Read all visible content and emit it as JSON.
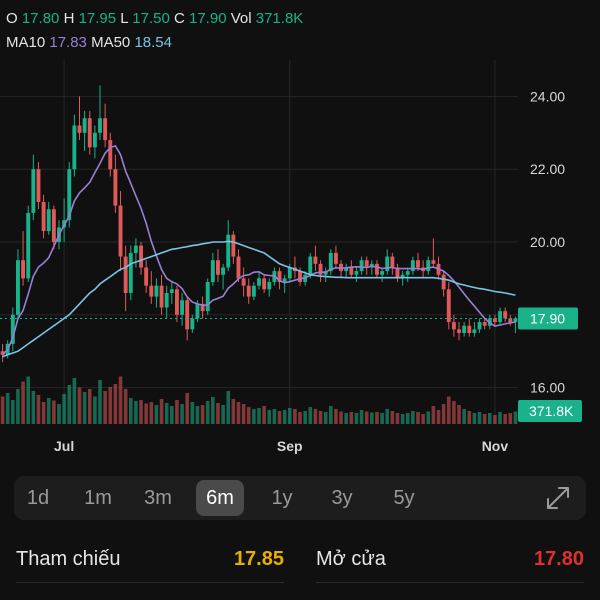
{
  "header": {
    "o_label": "O",
    "o_value": "17.80",
    "h_label": "H",
    "h_value": "17.95",
    "l_label": "L",
    "l_value": "17.50",
    "c_label": "C",
    "c_value": "17.90",
    "vol_label": "Vol",
    "vol_value": "371.8K",
    "ma10_label": "MA10",
    "ma10_value": "17.83",
    "ma50_label": "MA50",
    "ma50_value": "18.54"
  },
  "colors": {
    "up": "#19b28a",
    "down": "#e05a5a",
    "ma10": "#9a7fd6",
    "ma50": "#7cc4e6",
    "ref": "#e8b000"
  },
  "chart_data": {
    "type": "candlestick",
    "y_ticks": [
      "24.00",
      "22.00",
      "20.00",
      "16.00"
    ],
    "ylim": [
      15.0,
      25.0
    ],
    "x_ticks": [
      {
        "label": "Jul",
        "index": 12
      },
      {
        "label": "Sep",
        "index": 56
      },
      {
        "label": "Nov",
        "index": 96
      }
    ],
    "last_price_label": "17.90",
    "last_price": 17.9,
    "last_volume_label": "371.8K",
    "candles": [
      [
        17.0,
        17.2,
        16.7,
        16.9
      ],
      [
        16.9,
        17.3,
        16.8,
        17.2
      ],
      [
        17.2,
        18.2,
        17.0,
        18.0
      ],
      [
        18.0,
        19.8,
        17.9,
        19.5
      ],
      [
        19.5,
        20.3,
        18.8,
        19.0
      ],
      [
        19.0,
        21.0,
        18.9,
        20.8
      ],
      [
        20.8,
        22.4,
        20.6,
        22.0
      ],
      [
        22.0,
        22.2,
        20.9,
        21.1
      ],
      [
        21.1,
        21.3,
        20.1,
        20.3
      ],
      [
        20.3,
        21.1,
        20.2,
        20.9
      ],
      [
        20.9,
        21.0,
        19.8,
        20.0
      ],
      [
        20.0,
        20.6,
        19.8,
        20.4
      ],
      [
        20.4,
        21.2,
        20.0,
        20.6
      ],
      [
        20.6,
        22.2,
        20.4,
        22.0
      ],
      [
        22.0,
        23.5,
        21.8,
        23.2
      ],
      [
        23.2,
        24.0,
        22.8,
        23.0
      ],
      [
        23.0,
        23.6,
        22.5,
        23.4
      ],
      [
        23.4,
        23.6,
        22.4,
        22.6
      ],
      [
        22.6,
        23.2,
        22.3,
        23.0
      ],
      [
        23.0,
        24.3,
        22.8,
        23.4
      ],
      [
        23.4,
        23.8,
        22.6,
        22.8
      ],
      [
        22.8,
        23.0,
        21.8,
        22.0
      ],
      [
        22.0,
        22.4,
        20.8,
        21.0
      ],
      [
        21.0,
        21.4,
        19.2,
        19.6
      ],
      [
        19.6,
        19.9,
        18.1,
        18.6
      ],
      [
        18.6,
        19.9,
        18.4,
        19.7
      ],
      [
        19.7,
        20.1,
        19.3,
        19.9
      ],
      [
        19.9,
        20.0,
        19.1,
        19.3
      ],
      [
        19.3,
        19.5,
        18.6,
        18.8
      ],
      [
        18.8,
        19.2,
        18.3,
        18.5
      ],
      [
        18.5,
        19.0,
        18.2,
        18.8
      ],
      [
        18.8,
        19.1,
        18.0,
        18.2
      ],
      [
        18.2,
        18.8,
        17.9,
        18.6
      ],
      [
        18.6,
        18.9,
        18.3,
        18.7
      ],
      [
        18.7,
        18.8,
        17.8,
        18.0
      ],
      [
        18.0,
        18.6,
        17.7,
        18.4
      ],
      [
        18.4,
        18.5,
        17.3,
        17.6
      ],
      [
        17.6,
        18.0,
        17.5,
        17.9
      ],
      [
        17.9,
        18.4,
        17.8,
        18.3
      ],
      [
        18.3,
        18.5,
        17.9,
        18.1
      ],
      [
        18.1,
        19.0,
        18.0,
        18.9
      ],
      [
        18.9,
        19.7,
        18.8,
        19.5
      ],
      [
        19.5,
        19.8,
        18.9,
        19.1
      ],
      [
        19.1,
        19.4,
        18.7,
        19.3
      ],
      [
        19.3,
        20.6,
        19.2,
        20.2
      ],
      [
        20.2,
        20.3,
        19.4,
        19.6
      ],
      [
        19.6,
        19.8,
        18.9,
        19.0
      ],
      [
        19.0,
        19.3,
        18.5,
        18.8
      ],
      [
        18.8,
        19.0,
        18.3,
        18.5
      ],
      [
        18.5,
        18.9,
        18.4,
        18.8
      ],
      [
        18.8,
        19.2,
        18.7,
        19.0
      ],
      [
        19.0,
        19.1,
        18.6,
        18.7
      ],
      [
        18.7,
        19.0,
        18.5,
        18.9
      ],
      [
        18.9,
        19.3,
        18.8,
        19.2
      ],
      [
        19.2,
        19.3,
        18.7,
        18.9
      ],
      [
        18.9,
        19.1,
        18.6,
        19.0
      ],
      [
        19.0,
        19.4,
        18.9,
        19.3
      ],
      [
        19.3,
        19.6,
        19.0,
        19.2
      ],
      [
        19.2,
        19.3,
        18.8,
        18.9
      ],
      [
        18.9,
        19.2,
        18.8,
        19.1
      ],
      [
        19.1,
        19.7,
        19.0,
        19.6
      ],
      [
        19.6,
        19.9,
        19.2,
        19.4
      ],
      [
        19.4,
        19.5,
        18.9,
        19.1
      ],
      [
        19.1,
        19.3,
        18.9,
        19.2
      ],
      [
        19.2,
        19.8,
        19.1,
        19.7
      ],
      [
        19.7,
        19.9,
        19.3,
        19.4
      ],
      [
        19.4,
        19.5,
        19.0,
        19.2
      ],
      [
        19.2,
        19.4,
        19.0,
        19.3
      ],
      [
        19.3,
        19.5,
        19.0,
        19.1
      ],
      [
        19.1,
        19.3,
        18.9,
        19.2
      ],
      [
        19.2,
        19.6,
        19.1,
        19.5
      ],
      [
        19.5,
        19.6,
        19.1,
        19.3
      ],
      [
        19.3,
        19.5,
        19.1,
        19.4
      ],
      [
        19.4,
        19.5,
        19.0,
        19.1
      ],
      [
        19.1,
        19.3,
        18.9,
        19.2
      ],
      [
        19.2,
        19.8,
        19.1,
        19.6
      ],
      [
        19.6,
        19.7,
        19.1,
        19.3
      ],
      [
        19.3,
        19.4,
        18.9,
        19.0
      ],
      [
        19.0,
        19.2,
        18.8,
        19.1
      ],
      [
        19.1,
        19.3,
        18.9,
        19.2
      ],
      [
        19.2,
        19.6,
        19.1,
        19.5
      ],
      [
        19.5,
        19.7,
        19.2,
        19.3
      ],
      [
        19.3,
        19.5,
        19.0,
        19.2
      ],
      [
        19.2,
        19.6,
        19.1,
        19.5
      ],
      [
        19.5,
        20.1,
        19.3,
        19.4
      ],
      [
        19.4,
        19.6,
        19.0,
        19.1
      ],
      [
        19.1,
        19.2,
        18.5,
        18.7
      ],
      [
        18.7,
        18.9,
        17.6,
        17.8
      ],
      [
        17.8,
        18.0,
        17.4,
        17.6
      ],
      [
        17.6,
        17.8,
        17.3,
        17.5
      ],
      [
        17.5,
        17.8,
        17.4,
        17.7
      ],
      [
        17.7,
        17.9,
        17.4,
        17.5
      ],
      [
        17.5,
        17.8,
        17.4,
        17.6
      ],
      [
        17.6,
        17.9,
        17.5,
        17.8
      ],
      [
        17.8,
        17.9,
        17.6,
        17.7
      ],
      [
        17.7,
        18.0,
        17.6,
        17.9
      ],
      [
        17.9,
        18.0,
        17.7,
        17.8
      ],
      [
        17.8,
        18.2,
        17.7,
        18.1
      ],
      [
        18.1,
        18.2,
        17.8,
        17.9
      ],
      [
        17.9,
        18.0,
        17.7,
        17.8
      ],
      [
        17.8,
        17.95,
        17.5,
        17.9
      ]
    ],
    "volumes": [
      0.55,
      0.62,
      0.48,
      0.7,
      0.85,
      0.95,
      0.66,
      0.58,
      0.44,
      0.52,
      0.47,
      0.4,
      0.6,
      0.78,
      0.92,
      0.73,
      0.64,
      0.7,
      0.55,
      0.88,
      0.66,
      0.74,
      0.8,
      0.95,
      0.7,
      0.52,
      0.46,
      0.48,
      0.41,
      0.44,
      0.38,
      0.5,
      0.42,
      0.36,
      0.48,
      0.4,
      0.62,
      0.44,
      0.36,
      0.38,
      0.46,
      0.54,
      0.42,
      0.38,
      0.66,
      0.5,
      0.44,
      0.4,
      0.34,
      0.3,
      0.32,
      0.36,
      0.28,
      0.3,
      0.26,
      0.28,
      0.32,
      0.3,
      0.24,
      0.26,
      0.34,
      0.3,
      0.26,
      0.24,
      0.36,
      0.3,
      0.25,
      0.22,
      0.24,
      0.22,
      0.28,
      0.25,
      0.23,
      0.24,
      0.22,
      0.3,
      0.26,
      0.22,
      0.2,
      0.22,
      0.26,
      0.24,
      0.2,
      0.25,
      0.36,
      0.28,
      0.4,
      0.55,
      0.46,
      0.38,
      0.3,
      0.26,
      0.22,
      0.24,
      0.2,
      0.22,
      0.18,
      0.24,
      0.2,
      0.22,
      0.25
    ],
    "ma50": [
      16.85,
      16.9,
      16.95,
      17.0,
      17.1,
      17.2,
      17.3,
      17.4,
      17.5,
      17.6,
      17.7,
      17.8,
      17.9,
      18.0,
      18.15,
      18.3,
      18.45,
      18.6,
      18.7,
      18.85,
      18.95,
      19.05,
      19.15,
      19.25,
      19.3,
      19.4,
      19.45,
      19.5,
      19.55,
      19.6,
      19.65,
      19.7,
      19.75,
      19.8,
      19.82,
      19.85,
      19.87,
      19.9,
      19.92,
      19.95,
      19.97,
      20.0,
      20.0,
      20.0,
      20.02,
      20.0,
      19.95,
      19.9,
      19.85,
      19.8,
      19.75,
      19.7,
      19.6,
      19.5,
      19.4,
      19.35,
      19.3,
      19.25,
      19.2,
      19.15,
      19.1,
      19.08,
      19.06,
      19.05,
      19.04,
      19.03,
      19.03,
      19.02,
      19.02,
      19.02,
      19.02,
      19.02,
      19.02,
      19.02,
      19.02,
      19.02,
      19.02,
      19.02,
      19.02,
      19.02,
      19.02,
      19.02,
      19.02,
      19.02,
      19.02,
      19.0,
      18.98,
      18.95,
      18.9,
      18.85,
      18.82,
      18.78,
      18.75,
      18.72,
      18.7,
      18.67,
      18.64,
      18.62,
      18.6,
      18.57,
      18.54
    ]
  },
  "timeframes": [
    "1d",
    "1m",
    "3m",
    "6m",
    "1y",
    "3y",
    "5y"
  ],
  "timeframe_active": "6m",
  "stats": {
    "ref_label": "Tham chiếu",
    "ref_value": "17.85",
    "open_label": "Mở cửa",
    "open_value": "17.80"
  }
}
